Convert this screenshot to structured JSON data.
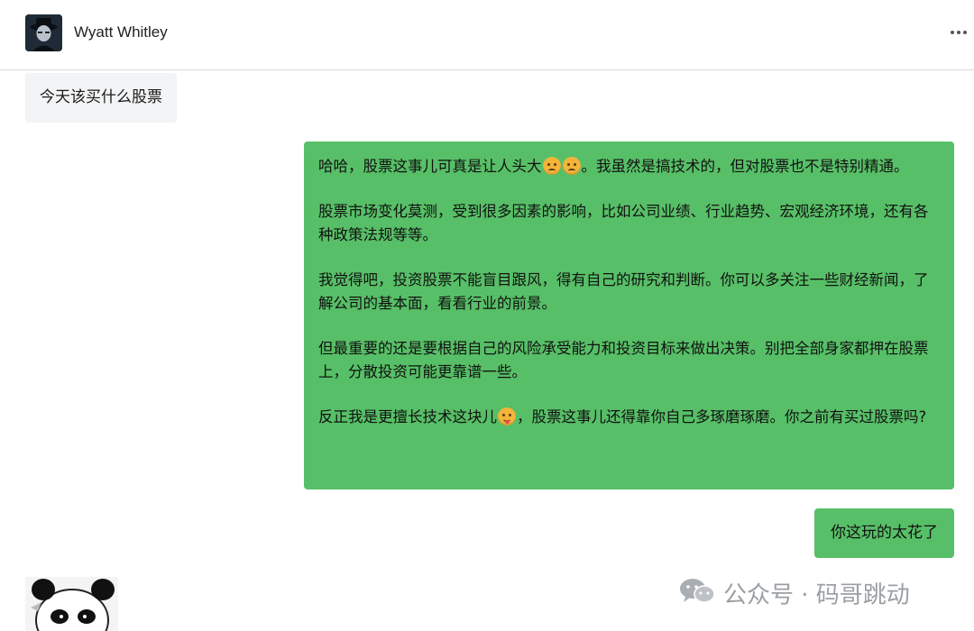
{
  "header": {
    "contact_name": "Wyatt Whitley",
    "more_icon": "more-horizontal-icon"
  },
  "messages": {
    "incoming_1": "今天该买什么股票",
    "outgoing_1": {
      "p1_before": "哈哈，股票这事儿可真是让人头大",
      "p1_emoji": "frown-face-icon",
      "p1_after": "。我虽然是搞技术的，但对股票也不是特别精通。",
      "p2": "股票市场变化莫测，受到很多因素的影响，比如公司业绩、行业趋势、宏观经济环境，还有各种政策法规等等。",
      "p3": "我觉得吧，投资股票不能盲目跟风，得有自己的研究和判断。你可以多关注一些财经新闻，了解公司的基本面，看看行业的前景。",
      "p4": "但最重要的还是要根据自己的风险承受能力和投资目标来做出决策。别把全部身家都押在股票上，分散投资可能更靠谱一些。",
      "p5_before": "反正我是更擅长技术这块儿",
      "p5_emoji": "zany-face-icon",
      "p5_after": "，股票这事儿还得靠你自己多琢磨琢磨。你之前有买过股票吗?"
    },
    "outgoing_2": "你这玩的太花了"
  },
  "watermark": {
    "text": "公众号 · 码哥跳动"
  },
  "colors": {
    "outgoing_bubble": "#57bf67",
    "incoming_bubble": "#f3f4f5",
    "divider": "#dcdcdc"
  }
}
